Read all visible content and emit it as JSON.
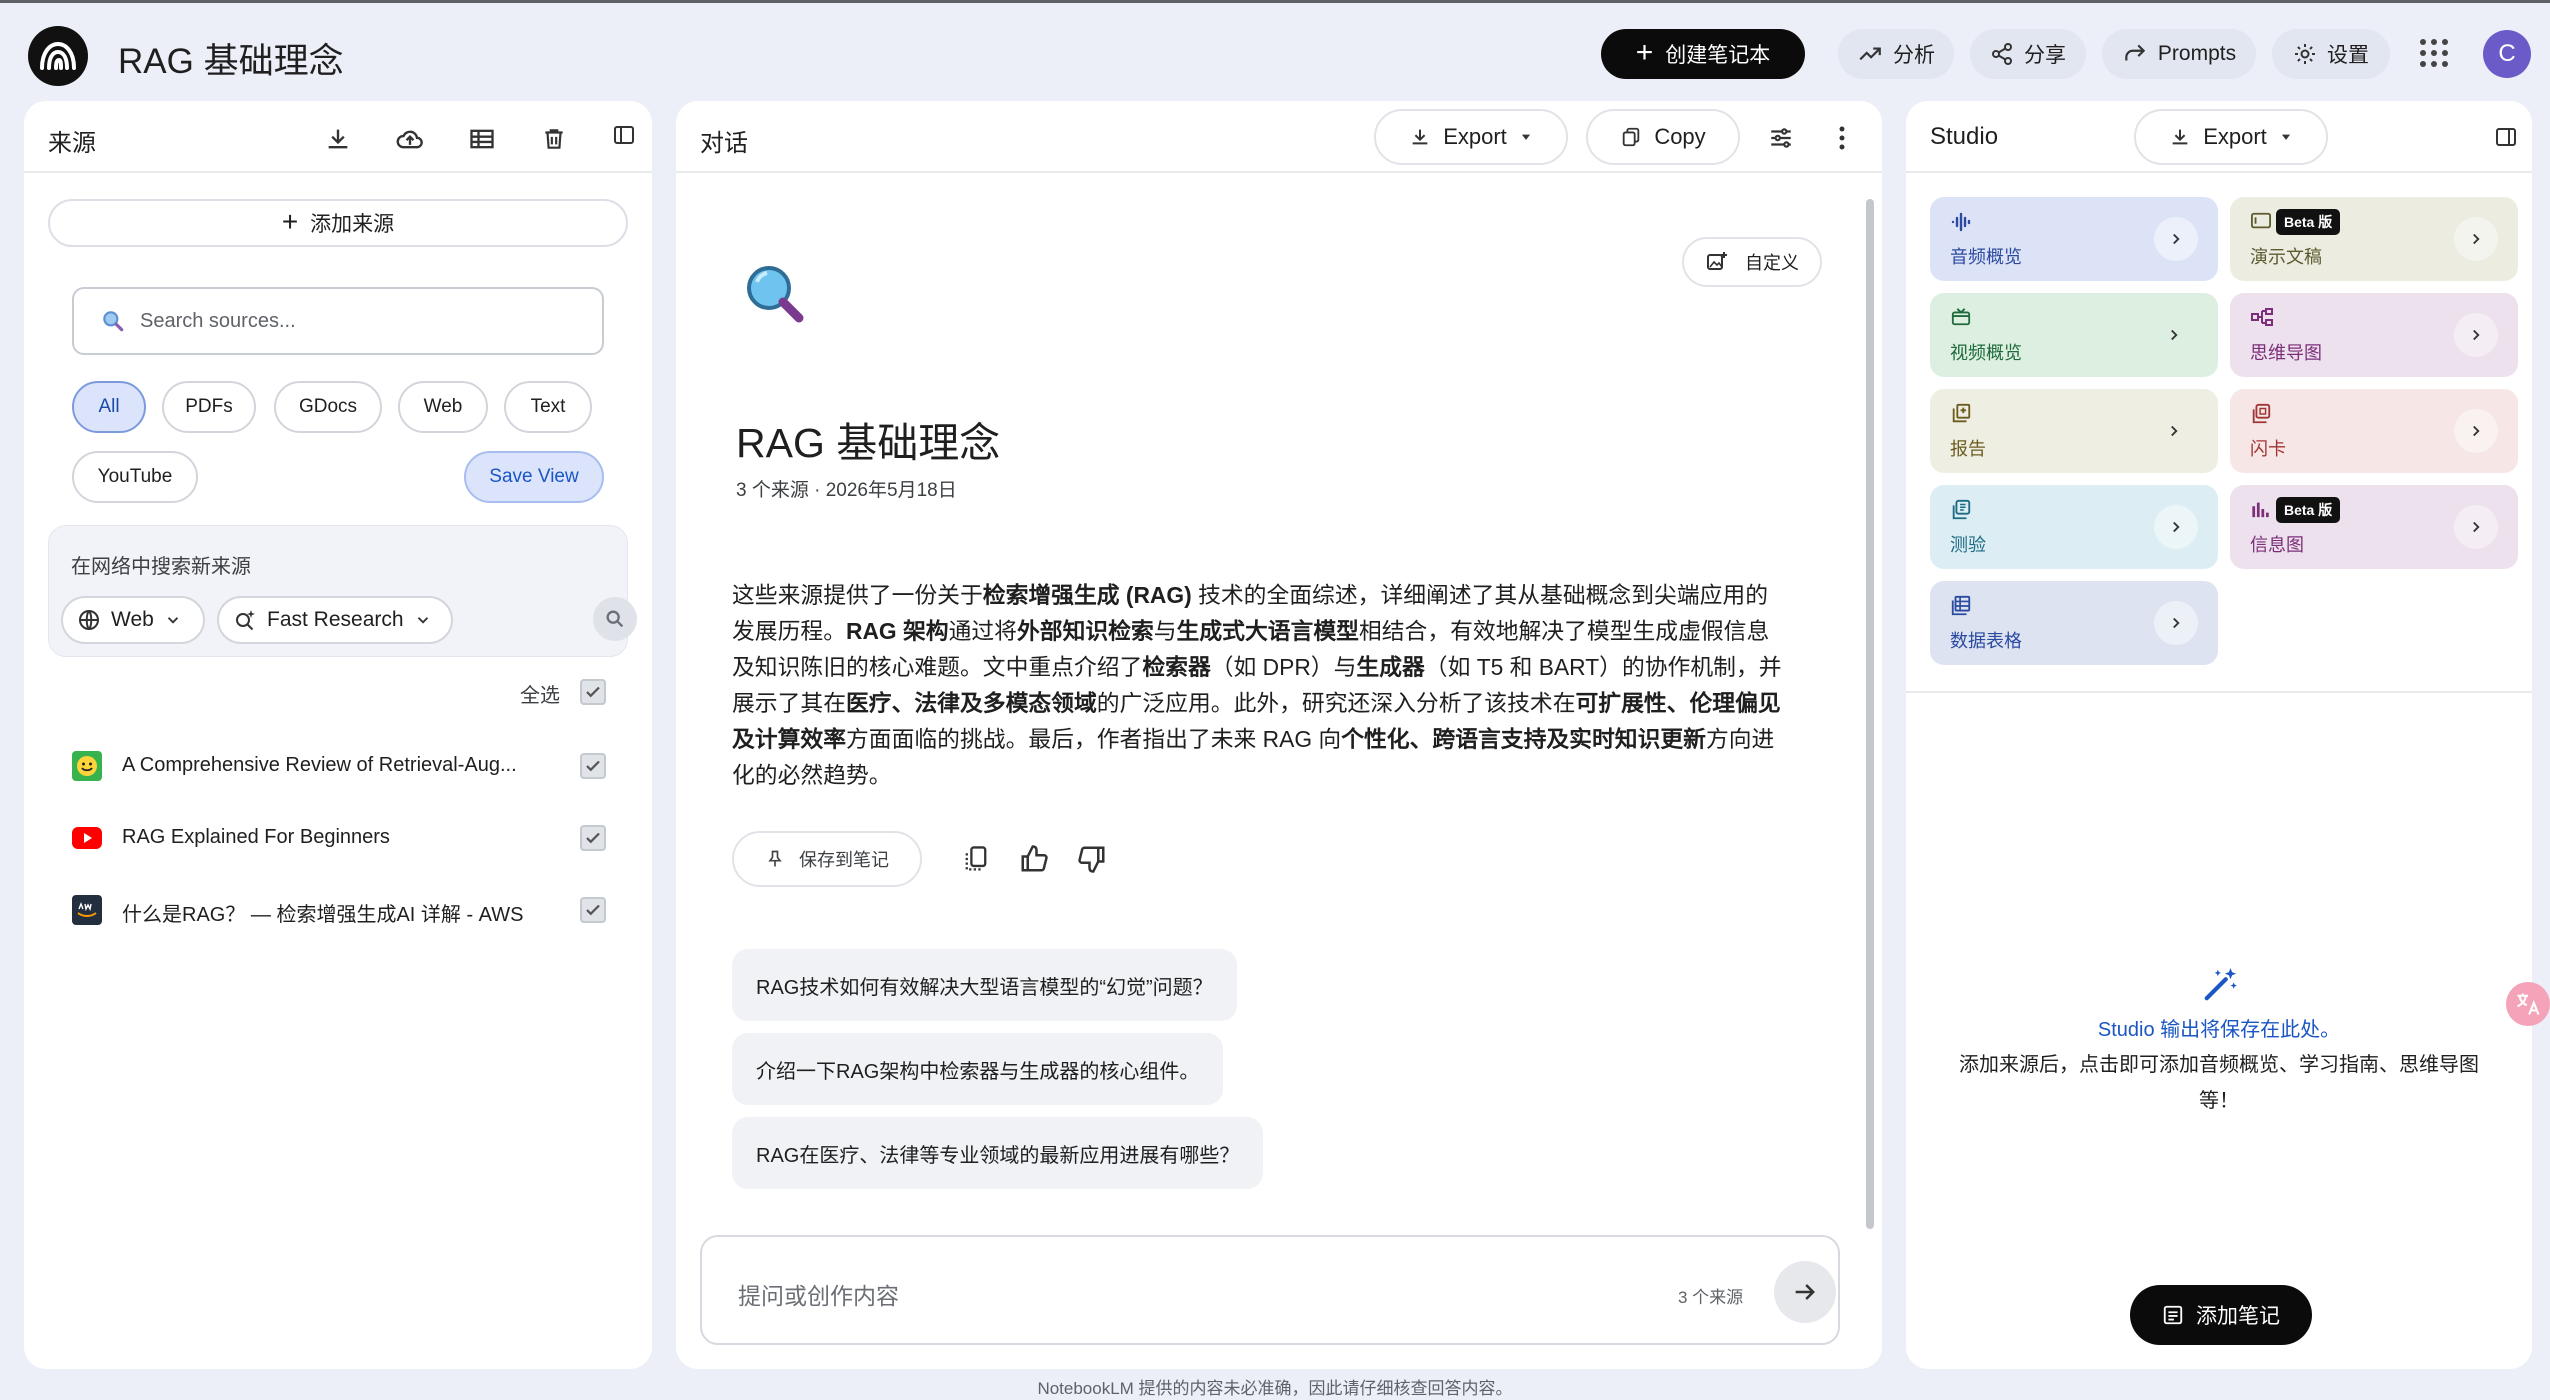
{
  "header": {
    "title": "RAG 基础理念",
    "create_label": "创建笔记本",
    "analyze_label": "分析",
    "share_label": "分享",
    "prompts_label": "Prompts",
    "settings_label": "设置",
    "avatar_letter": "C"
  },
  "sources": {
    "title": "来源",
    "add_label": "添加来源",
    "search_placeholder": "Search sources...",
    "filters": [
      "All",
      "PDFs",
      "GDocs",
      "Web",
      "Text",
      "YouTube"
    ],
    "active_filter": "All",
    "save_view_label": "Save View",
    "web_search_label": "在网络中搜索新来源",
    "web_dropdown": "Web",
    "research_dropdown": "Fast Research",
    "select_all_label": "全选",
    "items": [
      {
        "name": "A Comprehensive Review of Retrieval-Aug...",
        "icon": "smiley-pdf-icon",
        "checked": true
      },
      {
        "name": "RAG Explained For Beginners",
        "icon": "youtube-icon",
        "checked": true
      },
      {
        "name": "什么是RAG？ — 检索增强生成AI 详解 - AWS",
        "icon": "aws-icon",
        "checked": true
      }
    ]
  },
  "chat": {
    "title": "对话",
    "export_label": "Export",
    "copy_label": "Copy",
    "customize_label": "自定义",
    "doc_title": "RAG 基础理念",
    "doc_meta": "3 个来源 · 2026年5月18日",
    "summary_parts": [
      {
        "t": "这些来源提供了一份关于",
        "b": false
      },
      {
        "t": "检索增强生成 (RAG)",
        "b": true
      },
      {
        "t": " 技术的全面综述，详细阐述了其从基础概念到尖端应用的发展历程。",
        "b": false
      },
      {
        "t": "RAG 架构",
        "b": true
      },
      {
        "t": "通过将",
        "b": false
      },
      {
        "t": "外部知识检索",
        "b": true
      },
      {
        "t": "与",
        "b": false
      },
      {
        "t": "生成式大语言模型",
        "b": true
      },
      {
        "t": "相结合，有效地解决了模型生成虚假信息及知识陈旧的核心难题。文中重点介绍了",
        "b": false
      },
      {
        "t": "检索器",
        "b": true
      },
      {
        "t": "（如 DPR）与",
        "b": false
      },
      {
        "t": "生成器",
        "b": true
      },
      {
        "t": "（如 T5 和 BART）的协作机制，并展示了其在",
        "b": false
      },
      {
        "t": "医疗、法律及多模态领域",
        "b": true
      },
      {
        "t": "的广泛应用。此外，研究还深入分析了该技术在",
        "b": false
      },
      {
        "t": "可扩展性、伦理偏见及计算效率",
        "b": true
      },
      {
        "t": "方面面临的挑战。最后，作者指出了未来 RAG 向",
        "b": false
      },
      {
        "t": "个性化、跨语言支持及实时知识更新",
        "b": true
      },
      {
        "t": "方向进化的必然趋势。",
        "b": false
      }
    ],
    "save_note_label": "保存到笔记",
    "suggestions": [
      "RAG技术如何有效解决大型语言模型的“幻觉”问题？",
      "介绍一下RAG架构中检索器与生成器的核心组件。",
      "RAG在医疗、法律等专业领域的最新应用进展有哪些？"
    ],
    "input_placeholder": "提问或创作内容",
    "source_count": "3 个来源"
  },
  "studio": {
    "title": "Studio",
    "export_label": "Export",
    "beta_label": "Beta 版",
    "tiles": [
      {
        "label": "音频概览",
        "icon": "audio-icon",
        "bg": "#dde3f7",
        "fg": "#2b4aa0",
        "beta": false
      },
      {
        "label": "演示文稿",
        "icon": "slides-icon",
        "bg": "#ecece1",
        "fg": "#5c5a2e",
        "beta": true
      },
      {
        "label": "视频概览",
        "icon": "video-icon",
        "bg": "#dcefe1",
        "fg": "#1f6b3b",
        "beta": false
      },
      {
        "label": "思维导图",
        "icon": "mindmap-icon",
        "bg": "#ece1ec",
        "fg": "#7d2e7a",
        "beta": false
      },
      {
        "label": "报告",
        "icon": "report-icon",
        "bg": "#efeee2",
        "fg": "#6a5c1e",
        "beta": false
      },
      {
        "label": "闪卡",
        "icon": "flashcard-icon",
        "bg": "#f6e6e6",
        "fg": "#a13434",
        "beta": false
      },
      {
        "label": "测验",
        "icon": "quiz-icon",
        "bg": "#dcedf3",
        "fg": "#1d6a85",
        "beta": false
      },
      {
        "label": "信息图",
        "icon": "infographic-icon",
        "bg": "#ece1ec",
        "fg": "#7d2e7a",
        "beta": true
      },
      {
        "label": "数据表格",
        "icon": "table-icon",
        "bg": "#dde3f0",
        "fg": "#2b4aa0",
        "beta": false
      }
    ],
    "empty_title": "Studio 输出将保存在此处。",
    "empty_desc": "添加来源后，点击即可添加音频概览、学习指南、思维导图等！",
    "add_note_label": "添加笔记"
  },
  "footer": "NotebookLM 提供的内容未必准确，因此请仔细核查回答内容。",
  "colors": {
    "accent": "#1a56c4",
    "page_bg": "#eceff8",
    "panel_bg": "#ffffff"
  }
}
